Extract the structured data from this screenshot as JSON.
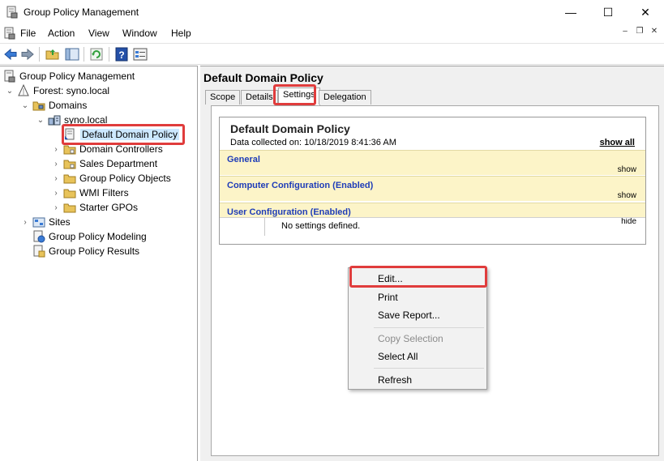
{
  "window": {
    "title": "Group Policy Management",
    "minimize_glyph": "—",
    "maximize_glyph": "☐",
    "close_glyph": "✕"
  },
  "menubar": {
    "items": [
      "File",
      "Action",
      "View",
      "Window",
      "Help"
    ],
    "mdi_minimize": "–",
    "mdi_restore": "❐",
    "mdi_close": "✕"
  },
  "toolbar": {
    "icons": [
      "back-arrow-icon",
      "forward-arrow-icon",
      "up-folder-icon",
      "show-hide-tree-icon",
      "refresh-icon",
      "help-icon",
      "properties-icon"
    ]
  },
  "tree": {
    "root": "Group Policy Management",
    "forest": "Forest: syno.local",
    "domains": "Domains",
    "domain": "syno.local",
    "items": [
      "Default Domain Policy",
      "Domain Controllers",
      "Sales Department",
      "Group Policy Objects",
      "WMI Filters",
      "Starter GPOs"
    ],
    "sites": "Sites",
    "modeling": "Group Policy Modeling",
    "results": "Group Policy Results",
    "expanded_glyph": "⌄",
    "collapsed_glyph": "›"
  },
  "details": {
    "title": "Default Domain Policy",
    "tabs": [
      "Scope",
      "Details",
      "Settings",
      "Delegation"
    ],
    "active_tab": "Settings"
  },
  "report": {
    "title": "Default Domain Policy",
    "collected": "Data collected on: 10/18/2019 8:41:36 AM",
    "show_all": "show all",
    "sections": [
      {
        "label": "General",
        "toggle": "show"
      },
      {
        "label": "Computer Configuration (Enabled)",
        "toggle": "show"
      },
      {
        "label": "User Configuration (Enabled)",
        "toggle": "hide"
      }
    ],
    "no_settings": "No settings defined."
  },
  "context_menu": {
    "edit": "Edit...",
    "print": "Print",
    "save_report": "Save Report...",
    "copy_selection": "Copy Selection",
    "select_all": "Select All",
    "refresh": "Refresh"
  },
  "colors": {
    "highlight": "#e03c3c",
    "section_bg": "#fcf4c8",
    "section_text": "#1e3cb8",
    "selection_bg": "#cce8ff"
  }
}
